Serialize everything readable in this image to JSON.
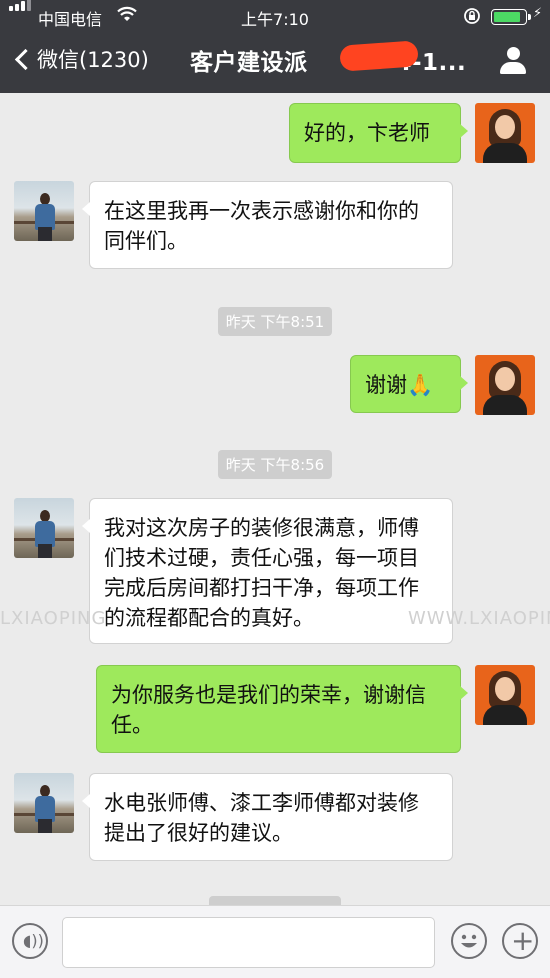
{
  "status_bar": {
    "carrier": "中国电信",
    "time": "上午7:10",
    "battery_level": 0.9,
    "wifi_icon": "wifi-icon",
    "lock_icon": "orientation-lock-icon",
    "charging_icon": "charging-bolt-icon"
  },
  "nav": {
    "back_label": "微信(1230)",
    "title": "客户建设派",
    "title_suffix": "4-1...",
    "profile_icon": "person-icon"
  },
  "messages": [
    {
      "side": "right",
      "text": "好的，卞老师"
    },
    {
      "side": "left",
      "text": "在这里我再一次表示感谢你和你的同伴们。"
    },
    {
      "timestamp": "昨天 下午8:51"
    },
    {
      "side": "right",
      "text": "谢谢🙏"
    },
    {
      "timestamp": "昨天 下午8:56"
    },
    {
      "side": "left",
      "text": "我对这次房子的装修很满意，师傅们技术过硬，责任心强，每一项目完成后房间都打扫干净，每项工作的流程都配合的真好。"
    },
    {
      "side": "right",
      "text": "为你服务也是我们的荣幸，谢谢信任。"
    },
    {
      "side": "left",
      "text": "水电张师傅、漆工李师傅都对装修提出了很好的建议。"
    }
  ],
  "watermark": {
    "left": "LXIAOPING",
    "right": "WWW.LXIAOPIN"
  },
  "input_bar": {
    "placeholder": "",
    "voice_icon": "voice-icon",
    "emoji_icon": "emoji-icon",
    "plus_icon": "plus-icon"
  },
  "colors": {
    "nav_bg": "#393a3f",
    "chat_bg": "#ebebeb",
    "sent_bubble": "#9ee95c",
    "received_bubble": "#ffffff"
  }
}
